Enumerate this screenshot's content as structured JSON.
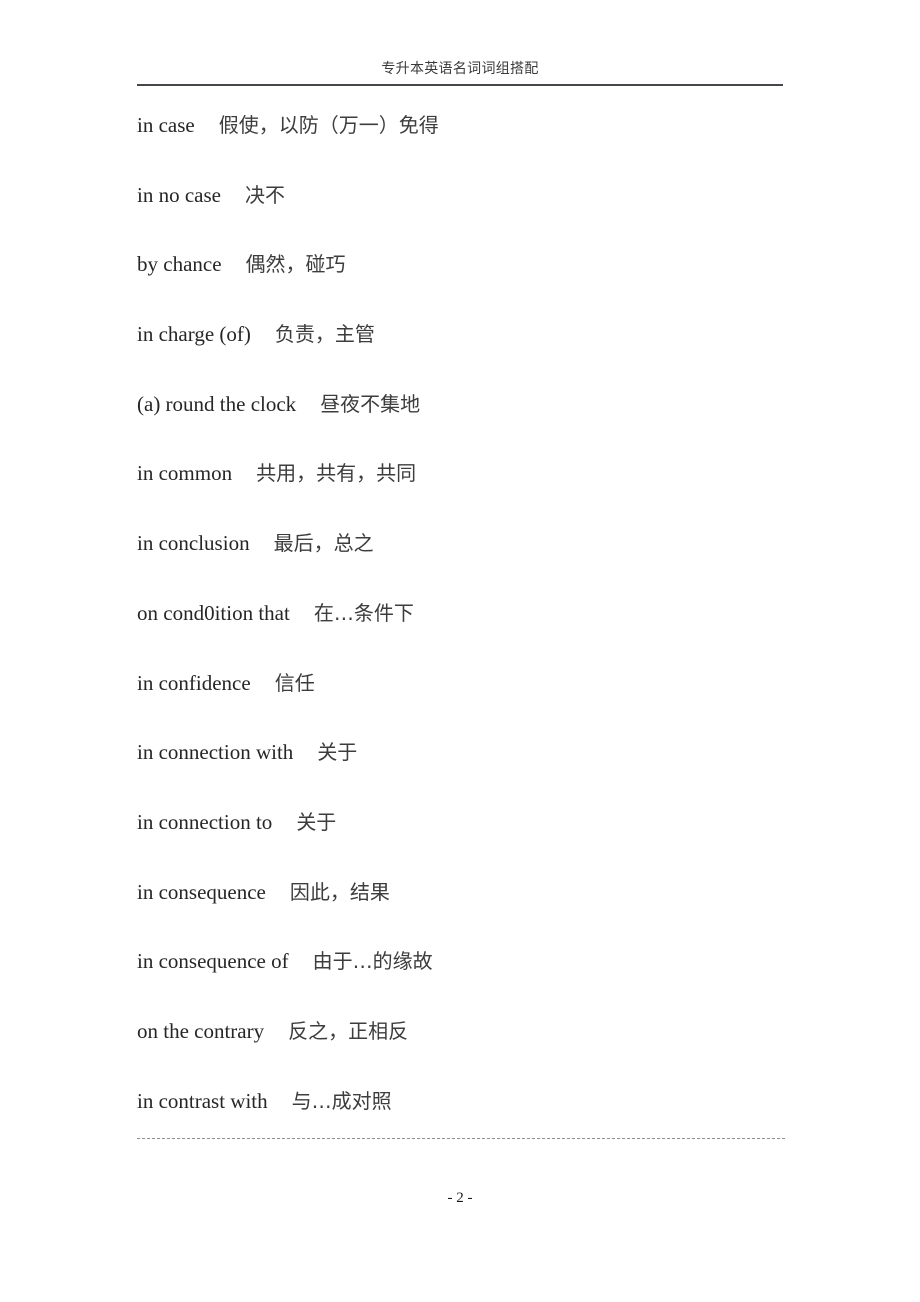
{
  "header": {
    "title": "专升本英语名词词组搭配"
  },
  "entries": [
    {
      "term": "in case",
      "gloss": "假使，以防（万一）免得"
    },
    {
      "term": "in no case",
      "gloss": "决不"
    },
    {
      "term": "by chance",
      "gloss": "偶然，碰巧"
    },
    {
      "term": "in charge (of)",
      "gloss": "负责，主管"
    },
    {
      "term": "(a) round the clock",
      "gloss": "昼夜不集地"
    },
    {
      "term": "in common",
      "gloss": "共用，共有，共同"
    },
    {
      "term": "in conclusion",
      "gloss": "最后，总之"
    },
    {
      "term": "on cond0ition that",
      "gloss": "在…条件下"
    },
    {
      "term": "in confidence",
      "gloss": "信任"
    },
    {
      "term": "in connection with",
      "gloss": "关于"
    },
    {
      "term": "in connection to",
      "gloss": "关于"
    },
    {
      "term": "in consequence",
      "gloss": "因此，结果"
    },
    {
      "term": "in consequence of",
      "gloss": "由于…的缘故"
    },
    {
      "term": "on the contrary",
      "gloss": "反之，正相反"
    },
    {
      "term": "in contrast with",
      "gloss": "与…成对照"
    }
  ],
  "footer": {
    "page_number": "- 2 -"
  }
}
